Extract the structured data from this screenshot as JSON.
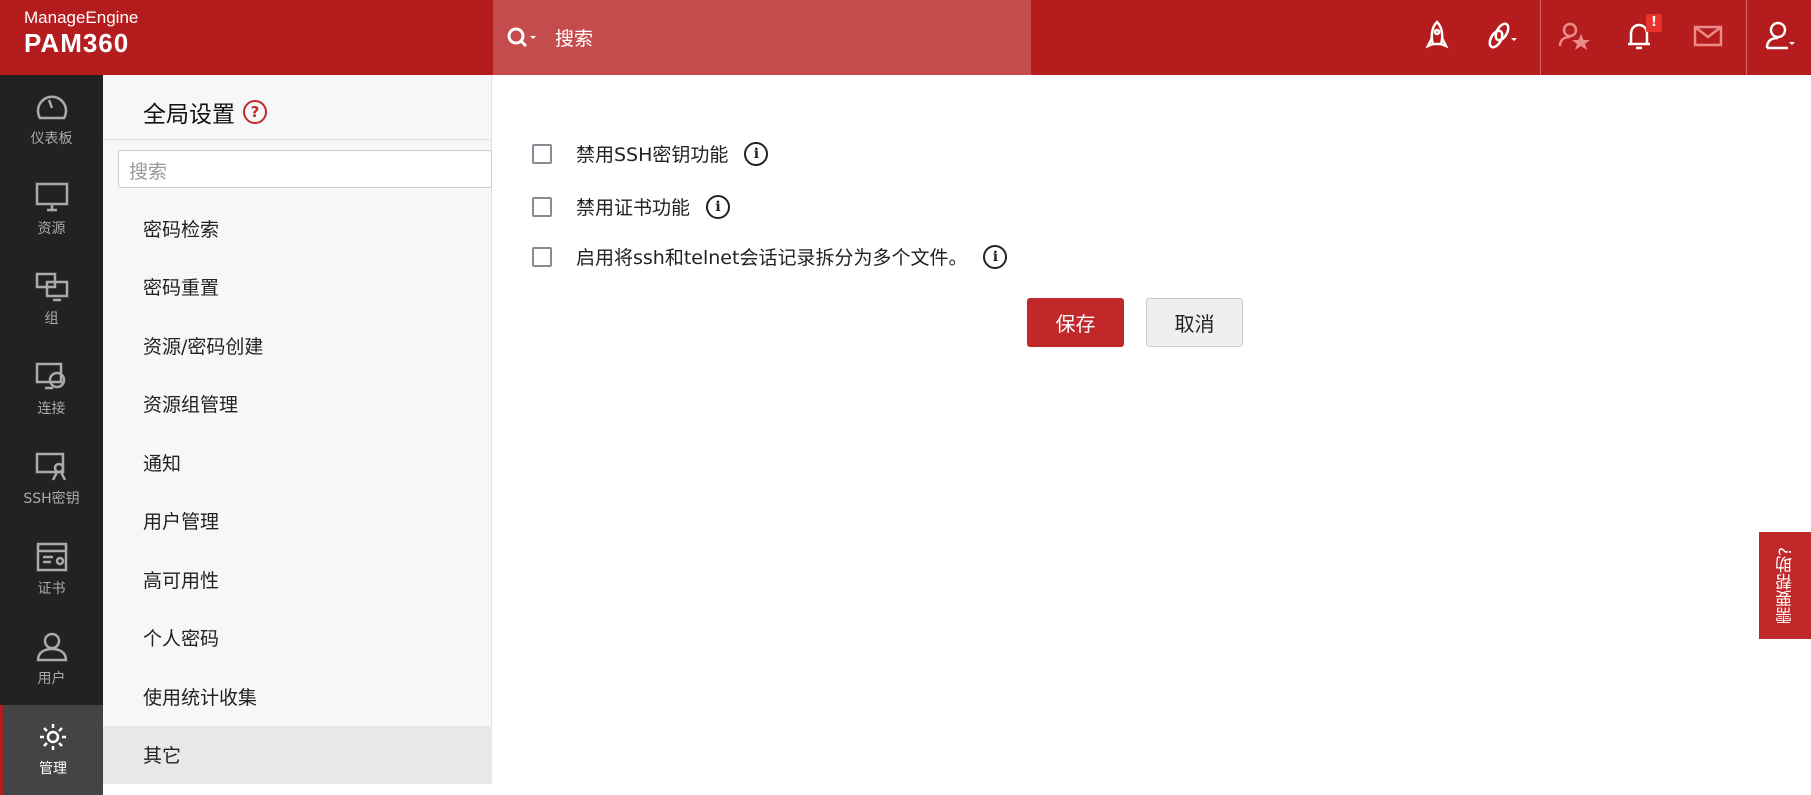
{
  "header": {
    "brand": "ManageEngine",
    "product": "PAM360",
    "search_placeholder": "搜索",
    "notification_badge": "!"
  },
  "nav": [
    {
      "label": "仪表板",
      "icon": "dashboard-icon"
    },
    {
      "label": "资源",
      "icon": "monitor-icon"
    },
    {
      "label": "组",
      "icon": "group-icon"
    },
    {
      "label": "连接",
      "icon": "connection-icon"
    },
    {
      "label": "SSH密钥",
      "icon": "ssh-key-icon"
    },
    {
      "label": "证书",
      "icon": "certificate-icon"
    },
    {
      "label": "用户",
      "icon": "user-icon"
    },
    {
      "label": "管理",
      "icon": "gear-icon",
      "active": true
    }
  ],
  "panel": {
    "title": "全局设置",
    "search_placeholder": "搜索",
    "items": [
      "密码检索",
      "密码重置",
      "资源/密码创建",
      "资源组管理",
      "通知",
      "用户管理",
      "高可用性",
      "个人密码",
      "使用统计收集",
      "其它"
    ],
    "active": "其它"
  },
  "main": {
    "options": [
      {
        "label": "禁用SSH密钥功能",
        "checked": false
      },
      {
        "label": "禁用证书功能",
        "checked": false
      },
      {
        "label": "启用将ssh和telnet会话记录拆分为多个文件。",
        "checked": false
      }
    ],
    "save": "保存",
    "cancel": "取消",
    "info_glyph": "i"
  },
  "help_tab": "需要帮助?",
  "colors": {
    "brand": "#b51c1e",
    "accent": "#c0282a"
  }
}
